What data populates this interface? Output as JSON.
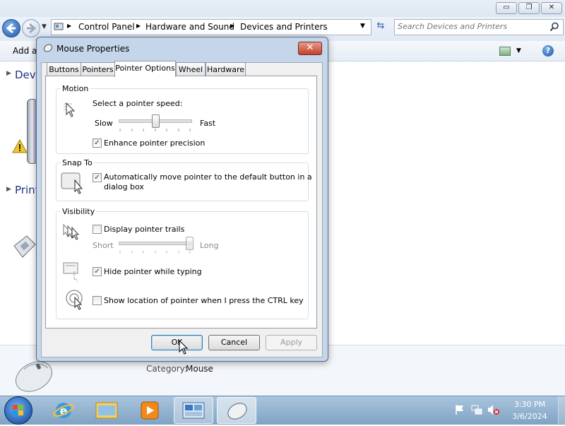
{
  "window": {
    "minimize": "▭",
    "maximize": "❐",
    "close": "✕"
  },
  "explorer": {
    "breadcrumb": [
      "Control Panel",
      "Hardware and Sound",
      "Devices and Printers"
    ],
    "search_placeholder": "Search Devices and Printers",
    "add_partial": "Add a",
    "section_devices_partial": "Devi",
    "section_printers_partial": "Print",
    "category_label": "Category:",
    "category_value": "Mouse"
  },
  "dialog": {
    "title": "Mouse Properties",
    "close": "✕",
    "tabs": [
      "Buttons",
      "Pointers",
      "Pointer Options",
      "Wheel",
      "Hardware"
    ],
    "selected_tab": "Pointer Options",
    "motion": {
      "group": "Motion",
      "speed_label": "Select a pointer speed:",
      "slow": "Slow",
      "fast": "Fast",
      "speed_value": 0.5,
      "enhance_label": "Enhance pointer precision",
      "enhance_checked": true
    },
    "snap": {
      "group": "Snap To",
      "label_line1": "Automatically move pointer to the default button in a",
      "label_line2": "dialog box",
      "checked": true
    },
    "visibility": {
      "group": "Visibility",
      "trails_label": "Display pointer trails",
      "trails_checked": false,
      "short": "Short",
      "long": "Long",
      "trails_value": 1.0,
      "hide_label": "Hide pointer while typing",
      "hide_checked": true,
      "ctrl_label": "Show location of pointer when I press the CTRL key",
      "ctrl_checked": false
    },
    "buttons": {
      "ok": "OK",
      "cancel": "Cancel",
      "apply": "Apply"
    }
  },
  "taskbar": {
    "time": "3:30 PM",
    "date": "3/6/2024"
  },
  "check_glyph": "✓"
}
